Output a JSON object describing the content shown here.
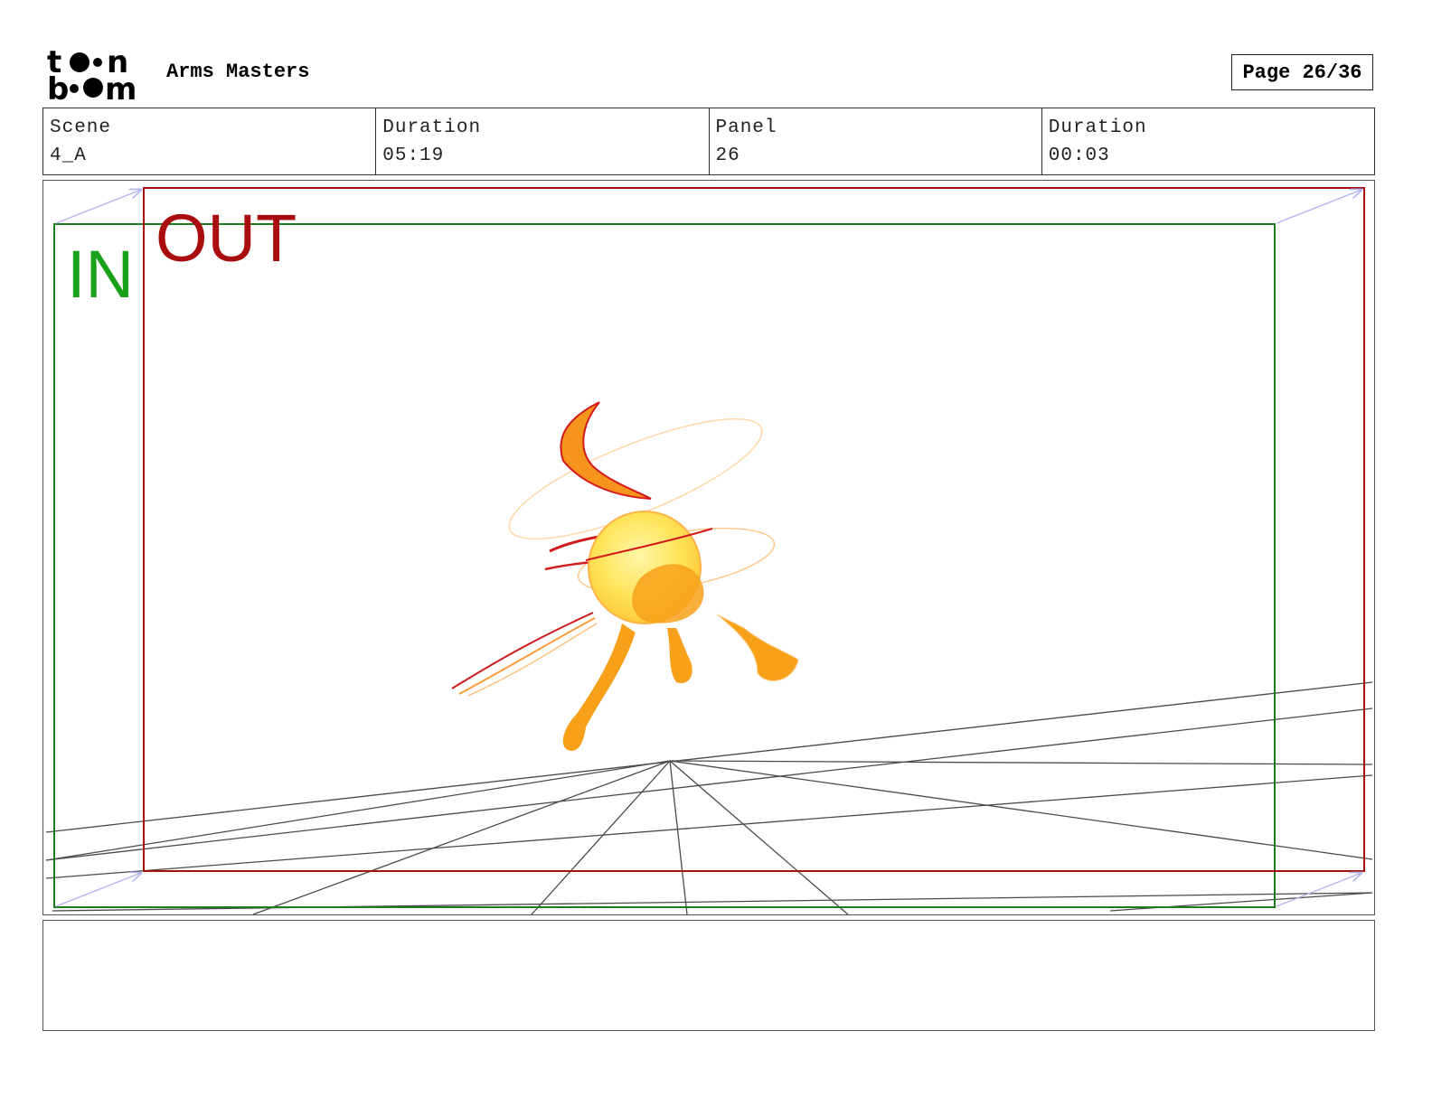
{
  "header": {
    "logo_text": "toon boom",
    "project_title": "Arms Masters",
    "page_label": "Page 26/36"
  },
  "info": {
    "scene_label": "Scene",
    "scene_value": "4_A",
    "scene_duration_label": "Duration",
    "scene_duration_value": "05:19",
    "panel_label": "Panel",
    "panel_value": "26",
    "panel_duration_label": "Duration",
    "panel_duration_value": "00:03"
  },
  "panel": {
    "in_label": "IN",
    "out_label": "OUT",
    "in_frame_color": "#1e7a1e",
    "out_frame_color": "#a80f0f",
    "motion_arrow_color": "#b3b3ee"
  },
  "notes": {
    "text": ""
  }
}
